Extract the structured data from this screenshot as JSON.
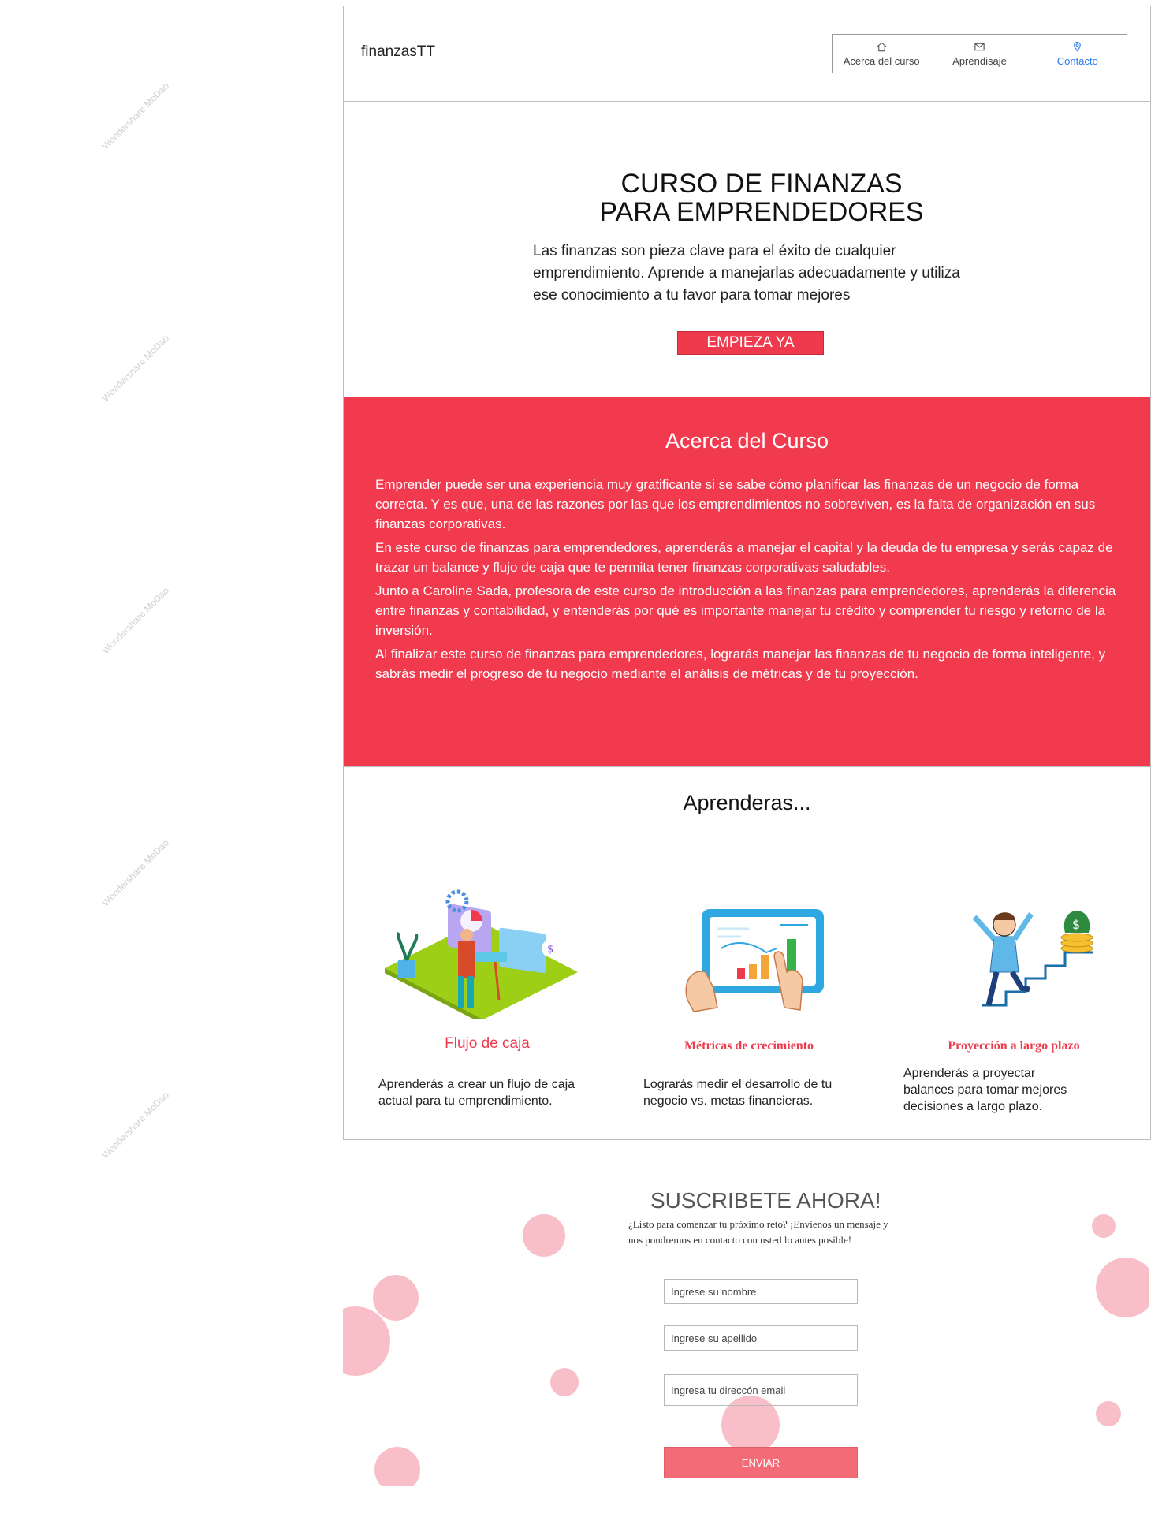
{
  "header": {
    "brand": "finanzasTT",
    "nav": [
      {
        "label": "Acerca del curso",
        "icon": "home-icon"
      },
      {
        "label": "Aprendisaje",
        "icon": "mail-icon"
      },
      {
        "label": "Contacto",
        "icon": "location-pin-icon",
        "active": true
      }
    ]
  },
  "hero": {
    "title_line1": "CURSO DE FINANZAS",
    "title_line2": "PARA EMPRENDEDORES",
    "text": "Las finanzas son pieza clave para el éxito de cualquier emprendimiento. Aprende a manejarlas adecuadamente y utiliza ese conocimiento a tu favor para tomar mejores",
    "cta": "EMPIEZA YA"
  },
  "about": {
    "title": "Acerca del Curso",
    "paragraphs": [
      " Emprender puede ser una experiencia muy gratificante si se sabe cómo planificar las finanzas de un negocio de forma correcta. Y es que, una de las razones por las que los emprendimientos no sobreviven, es la falta de organización en sus finanzas corporativas.",
      "En este curso de finanzas para emprendedores, aprenderás a manejar el capital y la deuda de tu empresa y serás capaz de trazar un balance y flujo de caja que te permita tener finanzas corporativas saludables.",
      "Junto a Caroline Sada, profesora de este curso de introducción a las finanzas para emprendedores, aprenderás la diferencia entre finanzas y contabilidad, y entenderás por qué es importante manejar tu crédito y comprender tu riesgo y retorno de la inversión.",
      "Al finalizar este curso de finanzas para emprendedores, lograrás manejar las finanzas de tu negocio de forma inteligente, y sabrás medir el progreso de tu negocio mediante el análisis de métricas y de tu proyección."
    ]
  },
  "learn": {
    "title": "Aprenderas...",
    "cards": [
      {
        "title": "Flujo de caja",
        "text": " Aprenderás a crear un flujo de caja actual para tu emprendimiento.",
        "illustration": "cashflow-illustration"
      },
      {
        "title": "Métricas de crecimiento",
        "text": " Lograrás medir el desarrollo de tu negocio vs. metas financieras.",
        "illustration": "metrics-tablet-illustration"
      },
      {
        "title": "Proyección a largo plazo",
        "text": " Aprenderás a proyectar balances para tomar mejores decisiones a largo plazo.",
        "illustration": "money-stairs-illustration"
      }
    ]
  },
  "subscribe": {
    "title": "SUSCRIBETE AHORA!",
    "text": "¿Listo para comenzar tu próximo reto? ¡Envíenos un mensaje y nos pondremos en contacto con usted lo antes posible!",
    "name_placeholder": "Ingrese su nombre",
    "lastname_placeholder": "Ingrese su apellido",
    "email_placeholder": "Ingresa tu direccón email",
    "send": "ENVIAR"
  },
  "watermark": "Wondershare MoDao",
  "colors": {
    "accent": "#f23a4e",
    "active_nav": "#2a7ef0",
    "send_button": "#f36b77"
  }
}
